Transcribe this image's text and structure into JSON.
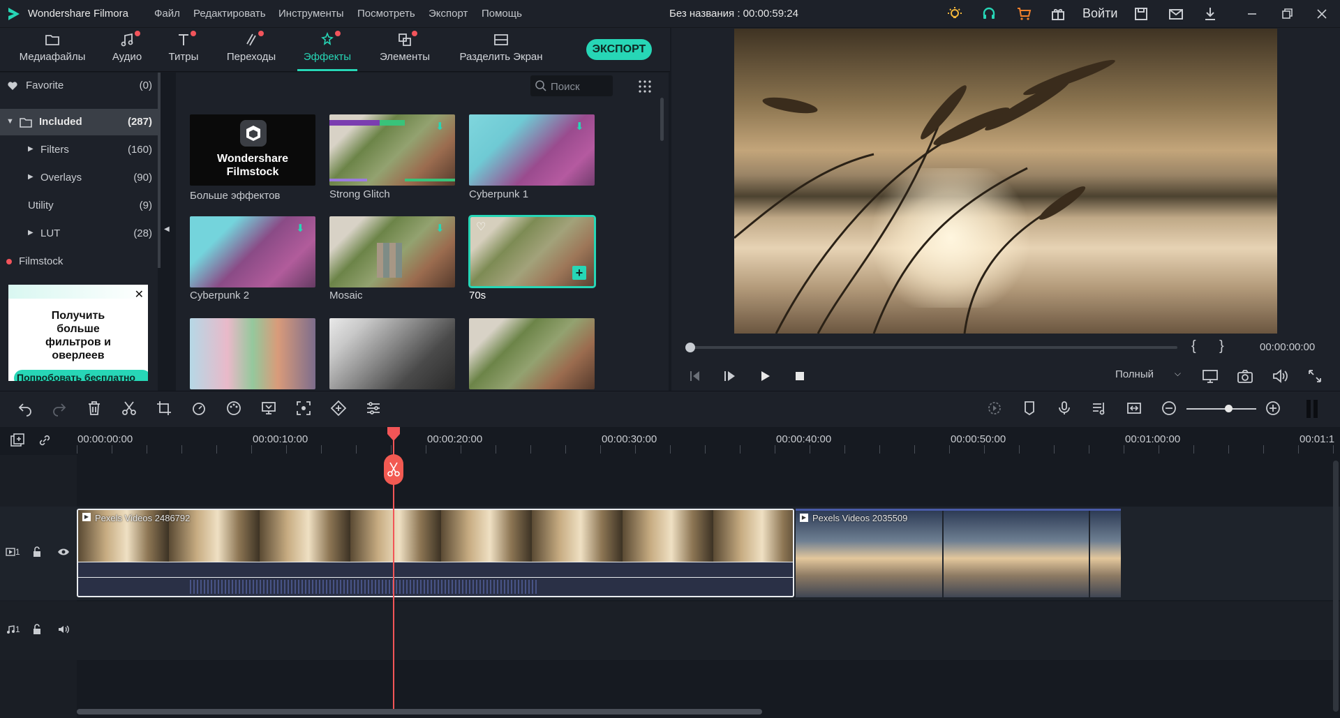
{
  "titlebar": {
    "app_title": "Wondershare Filmora",
    "menu": [
      "Файл",
      "Редактировать",
      "Инструменты",
      "Посмотреть",
      "Экспорт",
      "Помощь"
    ],
    "doc_title": "Без названия : 00:00:59:24",
    "login": "Войти"
  },
  "nav": {
    "tabs": [
      {
        "label": "Медиафайлы",
        "icon": "folder-icon"
      },
      {
        "label": "Аудио",
        "icon": "music-note-icon"
      },
      {
        "label": "Титры",
        "icon": "text-icon"
      },
      {
        "label": "Переходы",
        "icon": "transition-icon"
      },
      {
        "label": "Эффекты",
        "icon": "effects-icon"
      },
      {
        "label": "Элементы",
        "icon": "elements-icon"
      },
      {
        "label": "Разделить Экран",
        "icon": "split-screen-icon"
      }
    ],
    "active_tab": "Эффекты",
    "export_label": "ЭКСПОРТ"
  },
  "sidebar": {
    "items": [
      {
        "label": "Favorite",
        "count": "(0)"
      },
      {
        "label": "Included",
        "count": "(287)"
      },
      {
        "label": "Filters",
        "count": "(160)"
      },
      {
        "label": "Overlays",
        "count": "(90)"
      },
      {
        "label": "Utility",
        "count": "(9)"
      },
      {
        "label": "LUT",
        "count": "(28)"
      },
      {
        "label": "Filmstock",
        "count": ""
      }
    ],
    "ad_text": "Получить больше фильтров и оверлеев",
    "ad_button": "Попробовать бесплатно"
  },
  "effects": {
    "search_placeholder": "Поиск",
    "filmstock_card": "Wondershare Filmstock",
    "items": [
      "Больше эффектов",
      "Strong Glitch",
      "Cyberpunk 1",
      "Cyberpunk 2",
      "Mosaic",
      "70s"
    ]
  },
  "preview": {
    "timecode": "00:00:00:00",
    "quality": "Полный",
    "bracket_in": "{",
    "bracket_out": "}"
  },
  "timeline": {
    "ruler_labels": [
      "00:00:00:00",
      "00:00:10:00",
      "00:00:20:00",
      "00:00:30:00",
      "00:00:40:00",
      "00:00:50:00",
      "00:01:00:00",
      "00:01:1"
    ],
    "video_track_label": "1",
    "audio_track_label": "1",
    "clips": [
      "Pexels Videos 2486792",
      "Pexels Videos 2035509"
    ]
  },
  "colors": {
    "accent": "#27d6b6",
    "playhead": "#f25557",
    "badge": "#f2545b"
  }
}
